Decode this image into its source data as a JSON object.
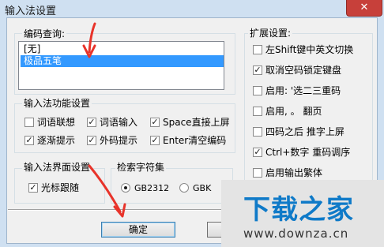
{
  "window": {
    "title": "输入法设置",
    "close_glyph": "✕"
  },
  "encoding_query": {
    "label": "编码查询:",
    "items": [
      {
        "label": "[无]",
        "selected": false
      },
      {
        "label": "极品五笔",
        "selected": true
      }
    ]
  },
  "function_settings": {
    "label": "输入法功能设置",
    "options": [
      {
        "label": "词语联想",
        "checked": false
      },
      {
        "label": "词语输入",
        "checked": true
      },
      {
        "label": "Space直接上屏",
        "checked": true
      },
      {
        "label": "逐渐提示",
        "checked": true
      },
      {
        "label": "外码提示",
        "checked": true
      },
      {
        "label": "Enter清空编码",
        "checked": true
      }
    ]
  },
  "ui_settings": {
    "label": "输入法界面设置",
    "options": [
      {
        "label": "光标跟随",
        "checked": true
      }
    ]
  },
  "charset": {
    "label": "检索字符集",
    "options": [
      {
        "label": "GB2312",
        "selected": true
      },
      {
        "label": "GBK",
        "selected": false
      }
    ]
  },
  "extended_settings": {
    "label": "扩展设置:",
    "options": [
      {
        "label": "左Shift键中英文切换",
        "checked": false
      },
      {
        "label": "取消空码锁定键盘",
        "checked": true
      },
      {
        "label": "启用: '选二三重码",
        "checked": false
      },
      {
        "label": "启用, 。 翻页",
        "checked": false
      },
      {
        "label": "四码之后 推字上屏",
        "checked": false
      },
      {
        "label": "Ctrl+数字 重码调序",
        "checked": true
      },
      {
        "label": "启用输出繁体",
        "checked": false
      }
    ]
  },
  "buttons": {
    "ok": "确定"
  },
  "watermark": {
    "main": "下载之家",
    "url": "www.downza.cn"
  },
  "annotation_color": "#e8332a"
}
